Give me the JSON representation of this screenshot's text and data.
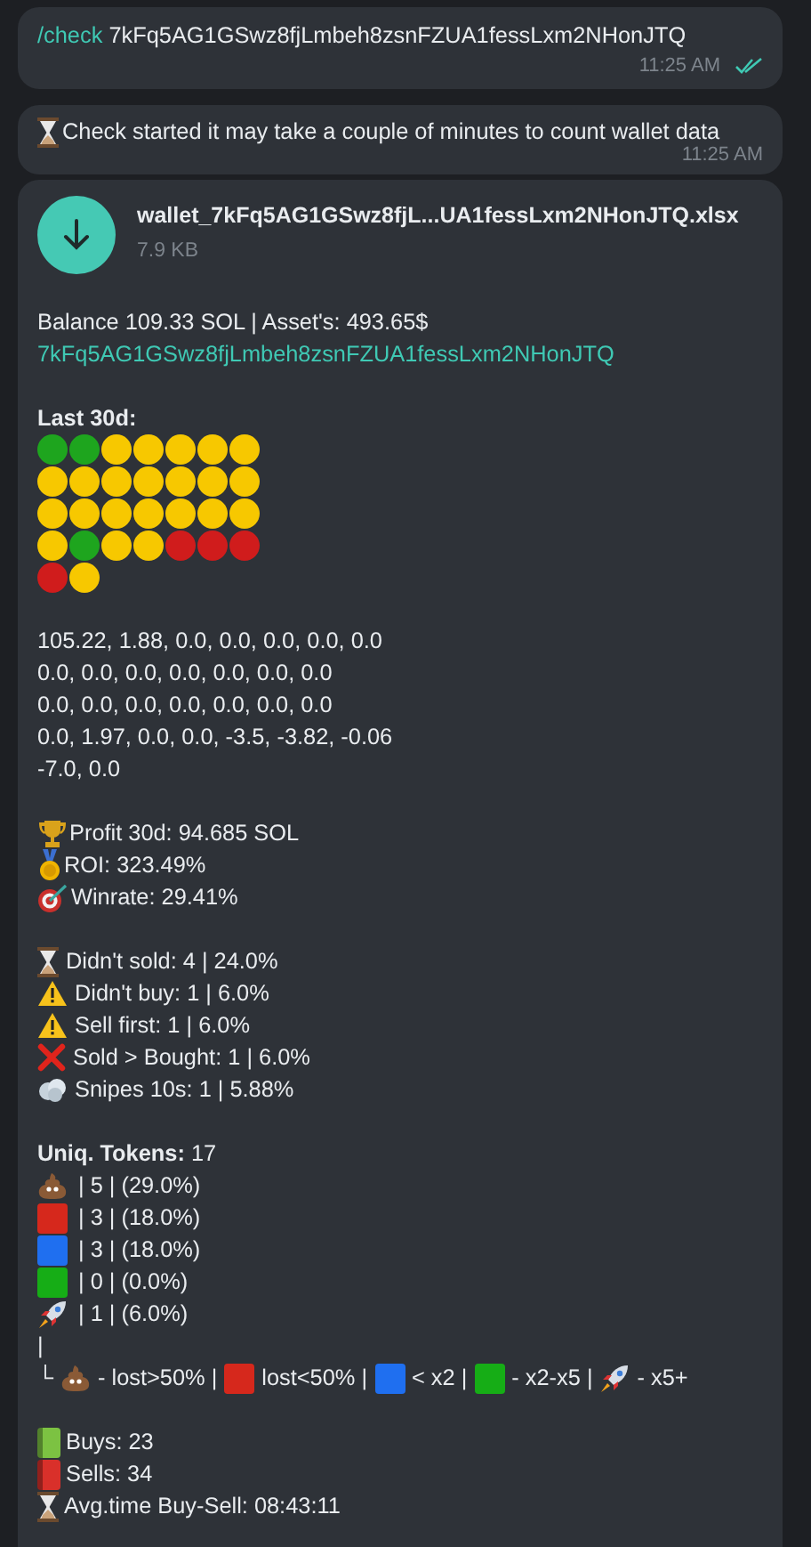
{
  "outgoing": {
    "command": "/check",
    "text": "7kFq5AG1GSwz8fjLmbeh8zsnFZUA1fessLxm2NHonJTQ",
    "time": "11:25 AM",
    "read": true
  },
  "notice": {
    "kind": "hourglass",
    "text": "Check started it may take a couple of minutes to count wallet data",
    "time": "11:25 AM"
  },
  "report": {
    "file": {
      "name": "wallet_7kFq5AG1GSwz8fjL...UA1fessLxm2NHonJTQ.xlsx",
      "size": "7.9 KB"
    },
    "balance": "Balance 109.33 SOL | Asset's: 493.65$",
    "address": "7kFq5AG1GSwz8fjLmbeh8zsnFZUA1fessLxm2NHonJTQ",
    "last30_label": "Last 30d:",
    "days": [
      {
        "color": "#1ea51e"
      },
      {
        "color": "#1ea51e"
      },
      {
        "color": "#f7c800"
      },
      {
        "color": "#f7c800"
      },
      {
        "color": "#f7c800"
      },
      {
        "color": "#f7c800"
      },
      {
        "color": "#f7c800"
      },
      {
        "color": "#f7c800"
      },
      {
        "color": "#f7c800"
      },
      {
        "color": "#f7c800"
      },
      {
        "color": "#f7c800"
      },
      {
        "color": "#f7c800"
      },
      {
        "color": "#f7c800"
      },
      {
        "color": "#f7c800"
      },
      {
        "color": "#f7c800"
      },
      {
        "color": "#f7c800"
      },
      {
        "color": "#f7c800"
      },
      {
        "color": "#f7c800"
      },
      {
        "color": "#f7c800"
      },
      {
        "color": "#f7c800"
      },
      {
        "color": "#f7c800"
      },
      {
        "color": "#f7c800"
      },
      {
        "color": "#1ea51e"
      },
      {
        "color": "#f7c800"
      },
      {
        "color": "#f7c800"
      },
      {
        "color": "#d01c1c"
      },
      {
        "color": "#d01c1c"
      },
      {
        "color": "#d01c1c"
      },
      {
        "color": "#d01c1c"
      },
      {
        "color": "#f7c800"
      }
    ],
    "pnl_lines": [
      "105.22, 1.88, 0.0, 0.0, 0.0, 0.0, 0.0",
      "0.0, 0.0, 0.0, 0.0, 0.0, 0.0, 0.0",
      "0.0, 0.0, 0.0, 0.0, 0.0, 0.0, 0.0",
      "0.0, 1.97, 0.0, 0.0, -3.5, -3.82, -0.06",
      "-7.0, 0.0"
    ],
    "stats": [
      {
        "kind": "trophy",
        "text": "Profit 30d: 94.685 SOL"
      },
      {
        "kind": "medal",
        "text": "ROI: 323.49%"
      },
      {
        "kind": "target",
        "text": "Winrate: 29.41%"
      }
    ],
    "checks": [
      {
        "kind": "hourglass",
        "text": "Didn't sold: 4 | 24.0%"
      },
      {
        "kind": "warning",
        "text": "Didn't buy: 1 | 6.0%"
      },
      {
        "kind": "warning",
        "text": "Sell first: 1 | 6.0%"
      },
      {
        "kind": "cross",
        "text": "Sold > Bought: 1 | 6.0%"
      },
      {
        "kind": "cloud",
        "text": "Snipes 10s: 1 | 5.88%"
      }
    ],
    "tokens_label": "**Uniq. Tokens:** 17",
    "tokens": [
      {
        "kind": "poop",
        "text": "| 5 | (29.0%)"
      },
      {
        "kind": "square",
        "color": "#d6281c",
        "text": "| 3 | (18.0%)"
      },
      {
        "kind": "square",
        "color": "#1f6ff0",
        "text": "| 3 | (18.0%)"
      },
      {
        "kind": "square",
        "color": "#16ad16",
        "text": "| 0 | (0.0%)"
      },
      {
        "kind": "rocket",
        "text": "| 1 | (6.0%)"
      }
    ],
    "pipe": "|",
    "legend": {
      "corner": "└",
      "items": [
        {
          "kind": "poop",
          "text": "- lost>50% |"
        },
        {
          "kind": "square",
          "color": "#d6281c",
          "text": "lost<50% |"
        },
        {
          "kind": "square",
          "color": "#1f6ff0",
          "text": "< x2 |"
        },
        {
          "kind": "square",
          "color": "#16ad16",
          "text": "- x2-x5 |"
        },
        {
          "kind": "rocket",
          "text": "- x5+"
        }
      ]
    },
    "trades": [
      {
        "kind": "book",
        "color": "#7cc242",
        "text": "Buys: 23"
      },
      {
        "kind": "book",
        "color": "#d9302a",
        "text": "Sells: 34"
      },
      {
        "kind": "hourglass",
        "text": "Avg.time Buy-Sell: 08:43:11"
      }
    ]
  }
}
